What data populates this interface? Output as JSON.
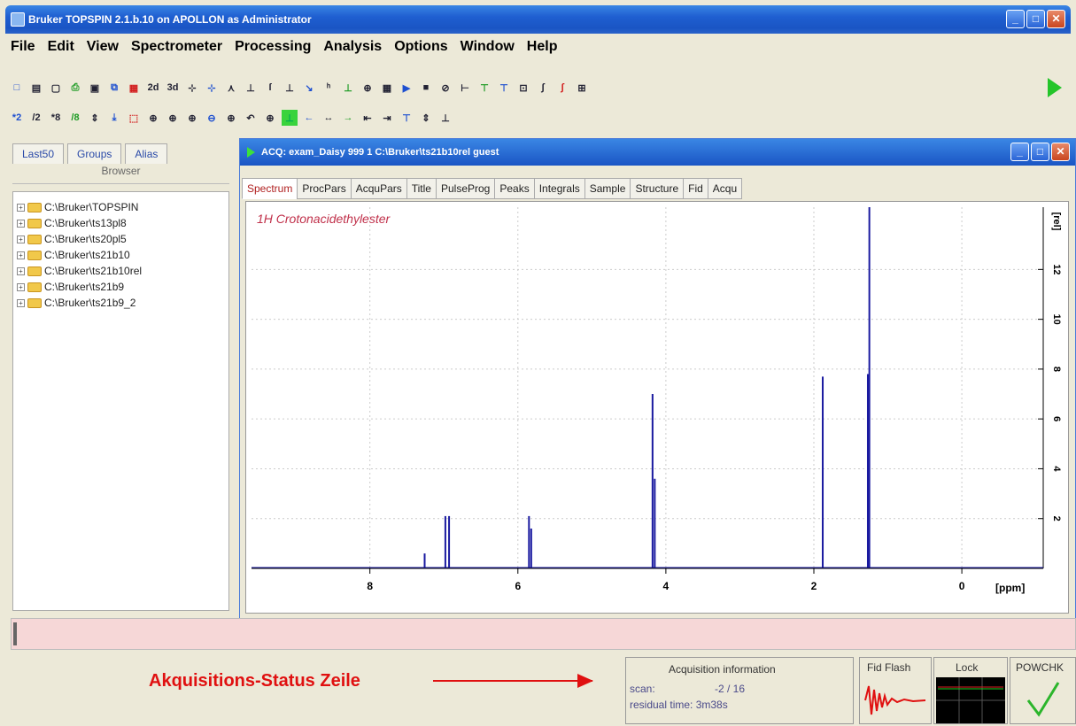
{
  "window": {
    "title": "Bruker TOPSPIN 2.1.b.10 on APOLLON as Administrator",
    "btn_min": "_",
    "btn_max": "□",
    "btn_close": "✕"
  },
  "menu": [
    "File",
    "Edit",
    "View",
    "Spectrometer",
    "Processing",
    "Analysis",
    "Options",
    "Window",
    "Help"
  ],
  "toolbar1": [
    "□",
    "▤",
    "▢",
    "⎙",
    "▣",
    "⧉",
    "▦",
    "2d",
    "3d",
    "⊹",
    "⊹",
    "⋏",
    "⊥",
    "ſ",
    "⊥",
    "↘",
    "ʰ",
    "⊥",
    "⊕",
    "▦",
    "▶",
    "■",
    "⊘",
    "⊢",
    "⊤",
    "⊤",
    "⊡",
    "∫",
    "∫",
    "⊞"
  ],
  "toolbar2": [
    "*2",
    "/2",
    "*8",
    "/8",
    "⇕",
    "⤓",
    "⬚",
    "⊕",
    "⊕",
    "⊕",
    "⊖",
    "⊕",
    "↶",
    "⊕",
    "⊥",
    "←",
    "↔",
    "→",
    "⇤",
    "⇥",
    "⊤",
    "⇕",
    "⊥"
  ],
  "left_panel": {
    "tabs": [
      "Last50",
      "Groups",
      "Alias"
    ],
    "browser_tab": "Browser",
    "tree": [
      "C:\\Bruker\\TOPSPIN",
      "C:\\Bruker\\ts13pl8",
      "C:\\Bruker\\ts20pl5",
      "C:\\Bruker\\ts21b10",
      "C:\\Bruker\\ts21b10rel",
      "C:\\Bruker\\ts21b9",
      "C:\\Bruker\\ts21b9_2"
    ]
  },
  "spectrum_window": {
    "title": "ACQ: exam_Daisy  999  1  C:\\Bruker\\ts21b10rel  guest",
    "tabs": [
      "Spectrum",
      "ProcPars",
      "AcquPars",
      "Title",
      "PulseProg",
      "Peaks",
      "Integrals",
      "Sample",
      "Structure",
      "Fid",
      "Acqu"
    ],
    "selected_tab": "Spectrum"
  },
  "chart_data": {
    "type": "line",
    "title": "1H Crotonacidethylester",
    "xlabel": "[ppm]",
    "ylabel": "[rel]",
    "xlim": [
      9.6,
      -1.1
    ],
    "ylim": [
      0,
      14.5
    ],
    "x_ticks": [
      "8",
      "6",
      "4",
      "2",
      "0"
    ],
    "y_ticks": [
      "2",
      "4",
      "6",
      "8",
      "10",
      "12"
    ],
    "peaks": [
      {
        "x": 7.26,
        "y": 0.6
      },
      {
        "x": 6.98,
        "y": 2.1
      },
      {
        "x": 6.93,
        "y": 2.1
      },
      {
        "x": 5.85,
        "y": 2.1
      },
      {
        "x": 5.82,
        "y": 1.6
      },
      {
        "x": 4.18,
        "y": 7.0
      },
      {
        "x": 4.15,
        "y": 3.6
      },
      {
        "x": 1.88,
        "y": 7.7
      },
      {
        "x": 1.27,
        "y": 7.8
      },
      {
        "x": 1.25,
        "y": 14.5
      }
    ],
    "grid": true
  },
  "status": {
    "annotation": "Akquisitions-Status Zeile",
    "acq_title": "Acquisition information",
    "scan_label": "scan:",
    "scan_value": "-2 / 16",
    "residual": "residual time: 3m38s",
    "fid_flash": "Fid Flash",
    "lock": "Lock",
    "powchk": "POWCHK",
    "check": "✓"
  },
  "colors": {
    "spectrum": "#1a1aa0",
    "title_text": "#c0304a",
    "annotation": "#e01010",
    "check": "#2bb52b"
  }
}
